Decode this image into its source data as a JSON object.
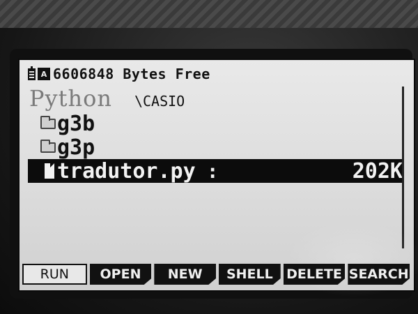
{
  "status": {
    "battery_icon": "battery-icon",
    "mode_icon_text": "A",
    "free_text": "6606848 Bytes Free"
  },
  "header": {
    "title": "Python",
    "path": "\\CASIO"
  },
  "files": [
    {
      "type": "folder",
      "name": "g3b"
    },
    {
      "type": "folder",
      "name": "g3p"
    },
    {
      "type": "file",
      "name": "tradutor.py",
      "separator": ":",
      "size": "202K",
      "selected": true
    }
  ],
  "function_keys": [
    {
      "label": "RUN"
    },
    {
      "label": "OPEN"
    },
    {
      "label": "NEW"
    },
    {
      "label": "SHELL"
    },
    {
      "label": "DELETE"
    },
    {
      "label": "SEARCH"
    }
  ],
  "colors": {
    "screen_bg": "#e0e0e0",
    "ink": "#111111",
    "highlight": "#0c0c0c"
  }
}
